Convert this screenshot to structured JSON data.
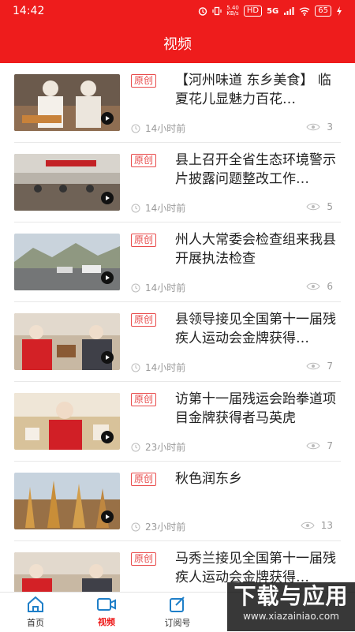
{
  "status_bar": {
    "time": "14:42",
    "network_speed": "5.40\nKB/s",
    "hd": "HD",
    "signal": "5G",
    "battery": "65"
  },
  "header": {
    "title": "视频"
  },
  "news_items": [
    {
      "tag": "原创",
      "headline": "【河州味道 东乡美食】 临夏花儿显魅力百花…",
      "time": "14小时前",
      "views": "3",
      "thumb": "thumb-chef"
    },
    {
      "tag": "原创",
      "headline": "县上召开全省生态环境警示片披露问题整改工作…",
      "time": "14小时前",
      "views": "5",
      "thumb": "thumb-meeting"
    },
    {
      "tag": "原创",
      "headline": "州人大常委会检查组来我县开展执法检查",
      "time": "14小时前",
      "views": "6",
      "thumb": "thumb-road"
    },
    {
      "tag": "原创",
      "headline": "县领导接见全国第十一届残疾人运动会金牌获得…",
      "time": "14小时前",
      "views": "7",
      "thumb": "thumb-reception"
    },
    {
      "tag": "原创",
      "headline": "访第十一届残运会跆拳道项目金牌获得者马英虎",
      "time": "23小时前",
      "views": "7",
      "thumb": "thumb-interview"
    },
    {
      "tag": "原创",
      "headline": "秋色润东乡",
      "time": "23小时前",
      "views": "13",
      "thumb": "thumb-harvest"
    },
    {
      "tag": "原创",
      "headline": "马秀兰接见全国第十一届残疾人运动会金牌获得…",
      "time": "",
      "views": "",
      "thumb": "thumb-reception"
    }
  ],
  "tabbar": {
    "items": [
      {
        "label": "首页",
        "icon": "home-icon"
      },
      {
        "label": "视频",
        "icon": "video-icon"
      },
      {
        "label": "订阅号",
        "icon": "subscribe-icon"
      }
    ]
  },
  "watermark": {
    "main": "下载与应用",
    "sub": "www.xiazainiao.com"
  },
  "colors": {
    "brand_red": "#ee1c1c",
    "tag_red": "#e84b4b",
    "text_gray": "#9a9a9a"
  }
}
